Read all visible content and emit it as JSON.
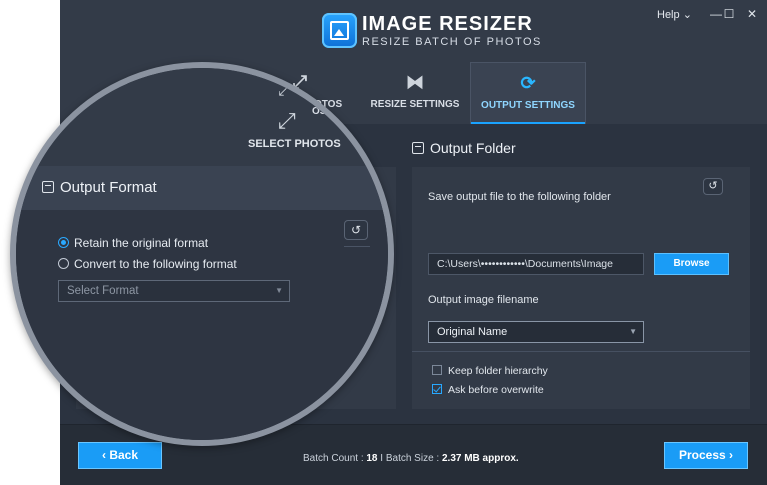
{
  "app": {
    "title": "IMAGE RESIZER",
    "subtitle": "RESIZE BATCH OF PHOTOS"
  },
  "window": {
    "help_label": "Help",
    "help_caret": "⌄",
    "minimize": "—",
    "maximize": "☐",
    "close": "✕"
  },
  "tabs": [
    {
      "label": "SELECT PHOTOS",
      "icon": "expand-arrows-icon",
      "glyph": "⤢"
    },
    {
      "label": "RESIZE SETTINGS",
      "icon": "resize-hourglass-icon",
      "glyph": "⧓"
    },
    {
      "label": "OUTPUT SETTINGS",
      "icon": "refresh-output-icon",
      "glyph": "⟳",
      "active": true
    }
  ],
  "output_format": {
    "header": "Output Format",
    "reset_glyph": "↺",
    "options": [
      {
        "label": "Retain the original format",
        "selected": true
      },
      {
        "label": "Convert to the following format",
        "selected": false
      }
    ],
    "select_placeholder": "Select Format",
    "caret": "▼"
  },
  "output_folder": {
    "header": "Output Folder",
    "save_label": "Save output file to the following folder",
    "path_value": "C:\\Users\\••••••••••••\\Documents\\Image",
    "browse_label": "Browse",
    "reset_glyph": "↺",
    "filename_label": "Output image filename",
    "filename_value": "Original Name",
    "caret": "▼",
    "checkboxes": [
      {
        "label": "Keep folder hierarchy",
        "checked": false
      },
      {
        "label": "Ask before overwrite",
        "checked": true
      }
    ]
  },
  "footer": {
    "back_label": "‹  Back",
    "process_label": "Process  ›",
    "batch_count_label": "Batch Count : ",
    "batch_count_value": "18",
    "batch_size_label": "  I Batch Size : ",
    "batch_size_value": "2.37 MB approx."
  },
  "colors": {
    "accent": "#1a9cf6",
    "bg": "#2f3744"
  }
}
